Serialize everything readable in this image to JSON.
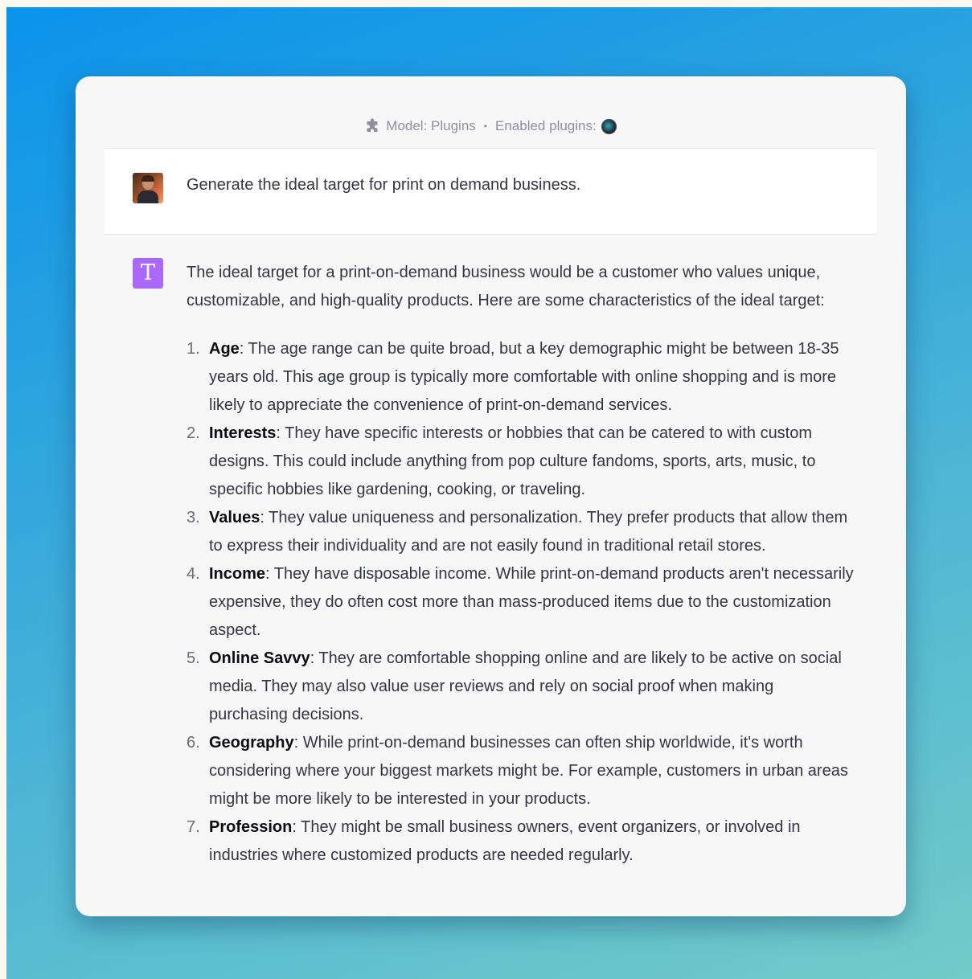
{
  "header": {
    "model_label": "Model: Plugins",
    "separator": "•",
    "plugins_label": "Enabled plugins:",
    "puzzle_icon": "puzzle-icon",
    "plugin_icon": "plugin-logo-icon"
  },
  "user_message": {
    "avatar": "user-avatar",
    "text": "Generate the ideal target for print on demand business."
  },
  "assistant_message": {
    "avatar_letter": "T",
    "avatar_color": "#ab68ff",
    "intro": "The ideal target for a print-on-demand business would be a customer who values unique, customizable, and high-quality products. Here are some characteristics of the ideal target:",
    "items": [
      {
        "number": "1.",
        "title": "Age",
        "text": ": The age range can be quite broad, but a key demographic might be between 18-35 years old. This age group is typically more comfortable with online shopping and is more likely to appreciate the convenience of print-on-demand services."
      },
      {
        "number": "2.",
        "title": "Interests",
        "text": ": They have specific interests or hobbies that can be catered to with custom designs. This could include anything from pop culture fandoms, sports, arts, music, to specific hobbies like gardening, cooking, or traveling."
      },
      {
        "number": "3.",
        "title": "Values",
        "text": ": They value uniqueness and personalization. They prefer products that allow them to express their individuality and are not easily found in traditional retail stores."
      },
      {
        "number": "4.",
        "title": "Income",
        "text": ": They have disposable income. While print-on-demand products aren't necessarily expensive, they do often cost more than mass-produced items due to the customization aspect."
      },
      {
        "number": "5.",
        "title": "Online Savvy",
        "text": ": They are comfortable shopping online and are likely to be active on social media. They may also value user reviews and rely on social proof when making purchasing decisions."
      },
      {
        "number": "6.",
        "title": "Geography",
        "text": ": While print-on-demand businesses can often ship worldwide, it's worth considering where your biggest markets might be. For example, customers in urban areas might be more likely to be interested in your products."
      },
      {
        "number": "7.",
        "title": "Profession",
        "text": ": They might be small business owners, event organizers, or involved in industries where customized products are needed regularly."
      }
    ]
  }
}
